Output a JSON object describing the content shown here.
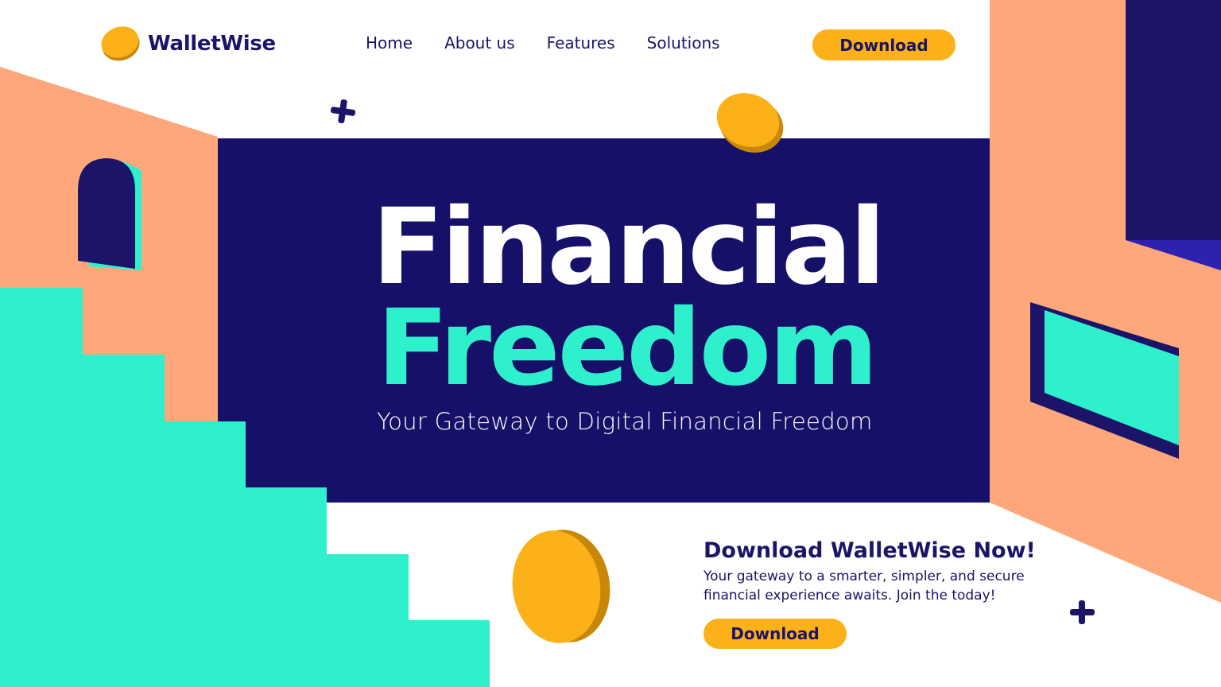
{
  "brand": {
    "name": "WalletWise"
  },
  "nav": {
    "items": [
      {
        "label": "Home"
      },
      {
        "label": "About us"
      },
      {
        "label": "Features"
      },
      {
        "label": "Solutions"
      }
    ],
    "download_label": "Download"
  },
  "hero": {
    "title_line1": "Financial",
    "title_line2": "Freedom",
    "subtitle": "Your Gateway to Digital Financial Freedom"
  },
  "cta": {
    "title": "Download WalletWise Now!",
    "body": "Your gateway to a smarter, simpler, and secure financial experience awaits. Join the today!",
    "button_label": "Download"
  },
  "colors": {
    "navy": "#1b1468",
    "peach": "#fda77b",
    "mint": "#2ff0cd",
    "gold": "#fbb117",
    "white": "#ffffff"
  },
  "icons": [
    "coin-icon",
    "plus-icon"
  ]
}
